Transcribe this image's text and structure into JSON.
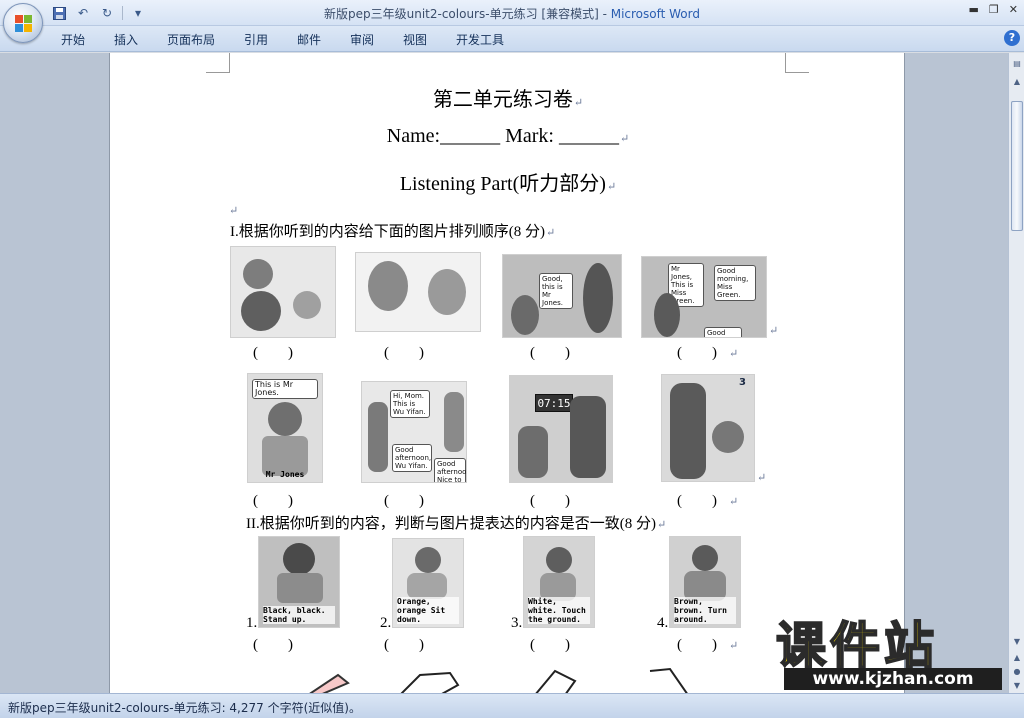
{
  "window": {
    "title": "新版pep三年级unit2-colours-单元练习 [兼容模式]",
    "title_sep": " - ",
    "app_name": "Microsoft Word"
  },
  "tabs": [
    "开始",
    "插入",
    "页面布局",
    "引用",
    "邮件",
    "审阅",
    "视图",
    "开发工具"
  ],
  "help_label": "?",
  "document": {
    "title": "第二单元练习卷",
    "name_line": "Name:______  Mark:  ______",
    "listening": "Listening Part(听力部分)",
    "section1": "I.根据你听到的内容给下面的图片排列顺序(8 分)",
    "section2": "II.根据你听到的内容，判断与图片提表达的内容是否一致(8 分)",
    "paren": "(        )",
    "row1_bubbles": [
      "Good, this is Mr Jones.",
      "Mr Jones, This is Miss Green.",
      "Good morning, Miss Green.",
      "Good morning."
    ],
    "row2_bubbles": [
      "This is Mr Jones.",
      "Hi, Mom. This is Wu Yifan.",
      "Good afternoon, Wu Yifan.",
      "Good afternoon. Nice to meet you."
    ],
    "row2_name": "Mr Jones",
    "clock": "07:15",
    "page_number": "3",
    "row3_captions": [
      "Black, black. Stand up.",
      "Orange, orange Sit down.",
      "White, white. Touch the ground.",
      "Brown, brown. Turn around."
    ],
    "row3_numbers": [
      "1.",
      "2.",
      "3.",
      "4."
    ]
  },
  "statusbar": {
    "text": "新版pep三年级unit2-colours-单元练习: 4,277 个字符(近似值)。"
  },
  "watermark": {
    "cn": "课件站",
    "url": "www.kjzhan.com"
  },
  "colors": {
    "accent": "#2a5db0",
    "watermark_yellow": "#ffe400"
  }
}
